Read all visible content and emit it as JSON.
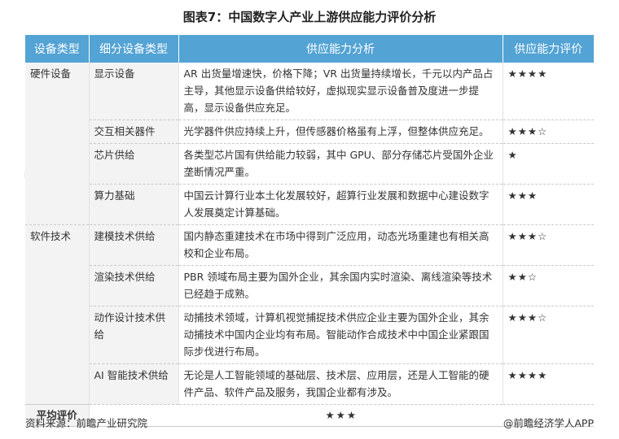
{
  "title": "图表7：中国数字人产业上游供应能力评价分析",
  "headers": [
    "设备类型",
    "细分设备类型",
    "供应能力分析",
    "供应能力评价"
  ],
  "categories": [
    {
      "name": "硬件设备",
      "rows": [
        {
          "sub": "显示设备",
          "analysis": "AR 出货量增速快，价格下降；VR 出货量持续增长，千元以内产品占主导，其他显示设备供给较好，虚拟现实显示设备普及度进一步提高，显示设备供应充足。",
          "rating": "★★★★"
        },
        {
          "sub": "交互相关器件",
          "analysis": "光学器件供应持续上升，但传感器价格虽有上浮，但整体供应充足。",
          "rating": "★★★☆"
        },
        {
          "sub": "芯片供给",
          "analysis": "各类型芯片国有供给能力较弱，其中 GPU、部分存储芯片受国外企业垄断情况严重。",
          "rating": "★"
        },
        {
          "sub": "算力基础",
          "analysis": "中国云计算行业本土化发展较好，超算行业发展和数据中心建设数字人发展奠定计算基础。",
          "rating": "★★★"
        }
      ]
    },
    {
      "name": "软件技术",
      "rows": [
        {
          "sub": "建模技术供给",
          "analysis": "国内静态重建技术在市场中得到广泛应用，动态光场重建也有相关高校和企业布局。",
          "rating": "★★★☆"
        },
        {
          "sub": "渲染技术供给",
          "analysis": "PBR 领域布局主要为国外企业，其余国内实时渲染、离线渲染等技术已经趋于成熟。",
          "rating": "★★☆"
        },
        {
          "sub": "动作设计技术供给",
          "analysis": "动捕技术领域，计算机视觉捕捉技术供应企业主要为国外企业，其余动捕技术中国内企业均有布局。智能动作合成技术中中国企业紧跟国际步伐进行布局。",
          "rating": "★★★☆"
        },
        {
          "sub": "AI 智能技术供给",
          "analysis": "无论是人工智能领域的基础层、技术层、应用层，还是人工智能的硬件产品、软件产品及服务，我国企业都有涉及。",
          "rating": "★★★★"
        }
      ]
    }
  ],
  "average": {
    "label": "平均评价",
    "rating": "★★★"
  },
  "footer": {
    "source": "资料来源：前瞻产业研究院",
    "brand": "@前瞻经济学人APP"
  },
  "watermark": "前瞻产业研究院",
  "colors": {
    "header_bg": "#53a3d4",
    "label_bg": "#f3f3f3"
  }
}
